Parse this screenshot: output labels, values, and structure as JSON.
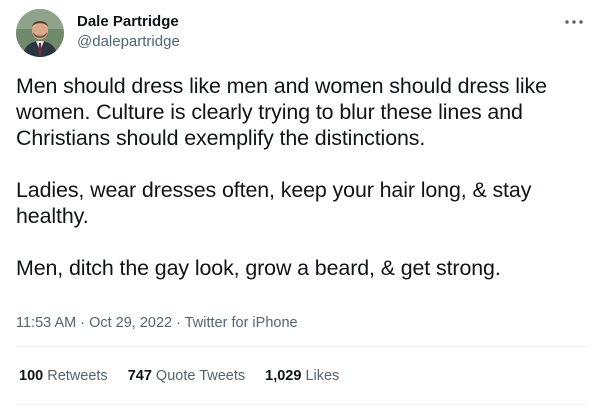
{
  "author": {
    "display_name": "Dale Partridge",
    "handle": "@dalepartridge",
    "avatar_icon": "profile-photo"
  },
  "more_icon": "ellipsis-icon",
  "tweet": {
    "paragraphs": [
      "Men should dress like men and women should dress like women. Culture is clearly trying to blur these lines and Christians should exemplify the distinctions.",
      "Ladies, wear dresses often, keep your hair long, & stay healthy.",
      "Men, ditch the gay look, grow a beard, & get strong."
    ]
  },
  "meta": {
    "time": "11:53 AM",
    "separator": " · ",
    "date": "Oct 29, 2022",
    "source": "Twitter for iPhone"
  },
  "stats": [
    {
      "count": "100",
      "label": "Retweets"
    },
    {
      "count": "747",
      "label": "Quote Tweets"
    },
    {
      "count": "1,029",
      "label": "Likes"
    }
  ],
  "colors": {
    "text": "#0f1419",
    "secondary": "#536471",
    "divider": "#eff3f4"
  }
}
